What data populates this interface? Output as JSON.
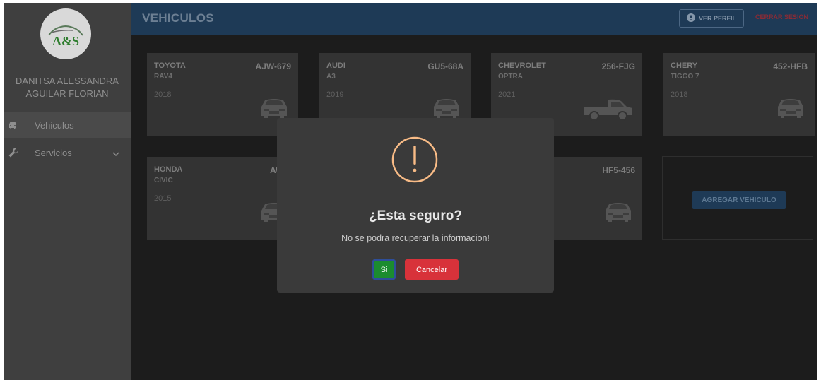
{
  "app": {
    "logo_text": "A&S",
    "user_name_line1": "DANITSA ALESSANDRA",
    "user_name_line2": "AGUILAR FLORIAN"
  },
  "sidebar": {
    "items": [
      {
        "label": "Vehiculos",
        "icon": "car-icon",
        "active": true
      },
      {
        "label": "Servicios",
        "icon": "wrench-icon",
        "has_submenu": true
      }
    ]
  },
  "header": {
    "title": "VEHICULOS",
    "profile_button": "VER PERFIL",
    "logout_button": "CERRAR SESION"
  },
  "vehicles": [
    {
      "brand": "TOYOTA",
      "model": "RAV4",
      "year": "2018",
      "plate": "AJW-679",
      "icon": "sedan-icon"
    },
    {
      "brand": "AUDI",
      "model": "A3",
      "year": "2019",
      "plate": "GU5-68A",
      "icon": "sedan-icon"
    },
    {
      "brand": "CHEVROLET",
      "model": "OPTRA",
      "year": "2021",
      "plate": "256-FJG",
      "icon": "pickup-icon"
    },
    {
      "brand": "CHERY",
      "model": "TIGGO 7",
      "year": "2018",
      "plate": "452-HFB",
      "icon": "sedan-icon"
    },
    {
      "brand": "HONDA",
      "model": "CIVIC",
      "year": "2015",
      "plate": "AW4-",
      "icon": "sedan-icon"
    },
    {
      "brand": "",
      "model": "",
      "year": "",
      "plate": "HF5-456",
      "icon": "sedan-icon"
    }
  ],
  "add_vehicle_button": "AGREGAR VEHICULO",
  "modal": {
    "icon": "warning-icon",
    "title": "¿Esta seguro?",
    "text": "No se podra recuperar la informacion!",
    "confirm_button": "Si",
    "cancel_button": "Cancelar"
  },
  "colors": {
    "header_bg": "#1e3a56",
    "confirm": "#1b8c2f",
    "cancel": "#d8323a",
    "warning": "#f8bb86"
  }
}
